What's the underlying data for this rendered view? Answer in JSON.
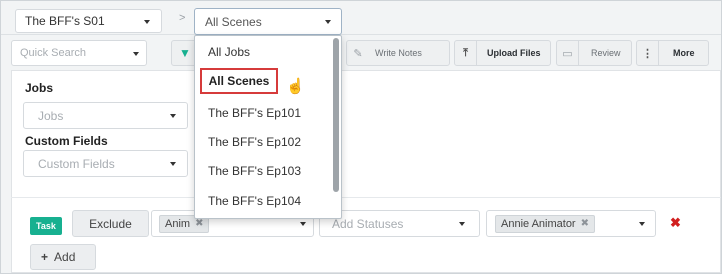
{
  "colors": {
    "accent_green": "#17b090",
    "selection_red": "#d63b3b",
    "delete_red": "#d11f1f"
  },
  "header": {
    "project_select": "The BFF's S01",
    "breadcrumb_separator": ">",
    "scene_select": "All Scenes"
  },
  "toolbar": {
    "search_placeholder": "Quick Search",
    "filter_icon": "funnel-icon",
    "write_notes_label": "Write Notes",
    "upload_files_label": "Upload Files",
    "review_label": "Review",
    "more_label": "More"
  },
  "filters": {
    "jobs_label": "Jobs",
    "jobs_placeholder": "Jobs",
    "custom_fields_label": "Custom Fields",
    "custom_fields_placeholder": "Custom Fields"
  },
  "dropdown": {
    "items": [
      "All Jobs",
      "All Scenes",
      "The BFF's Ep101",
      "The BFF's Ep102",
      "The BFF's Ep103",
      "The BFF's Ep104"
    ],
    "highlighted": "All Scenes",
    "cursor_icon": "hand-pointer-icon"
  },
  "rule": {
    "task_badge": "Task",
    "exclude_label": "Exclude",
    "anim_tag": "Anim",
    "statuses_placeholder": "Add Statuses",
    "user_tag": "Annie Animator",
    "delete_icon": "close-icon"
  },
  "add_button": "Add"
}
